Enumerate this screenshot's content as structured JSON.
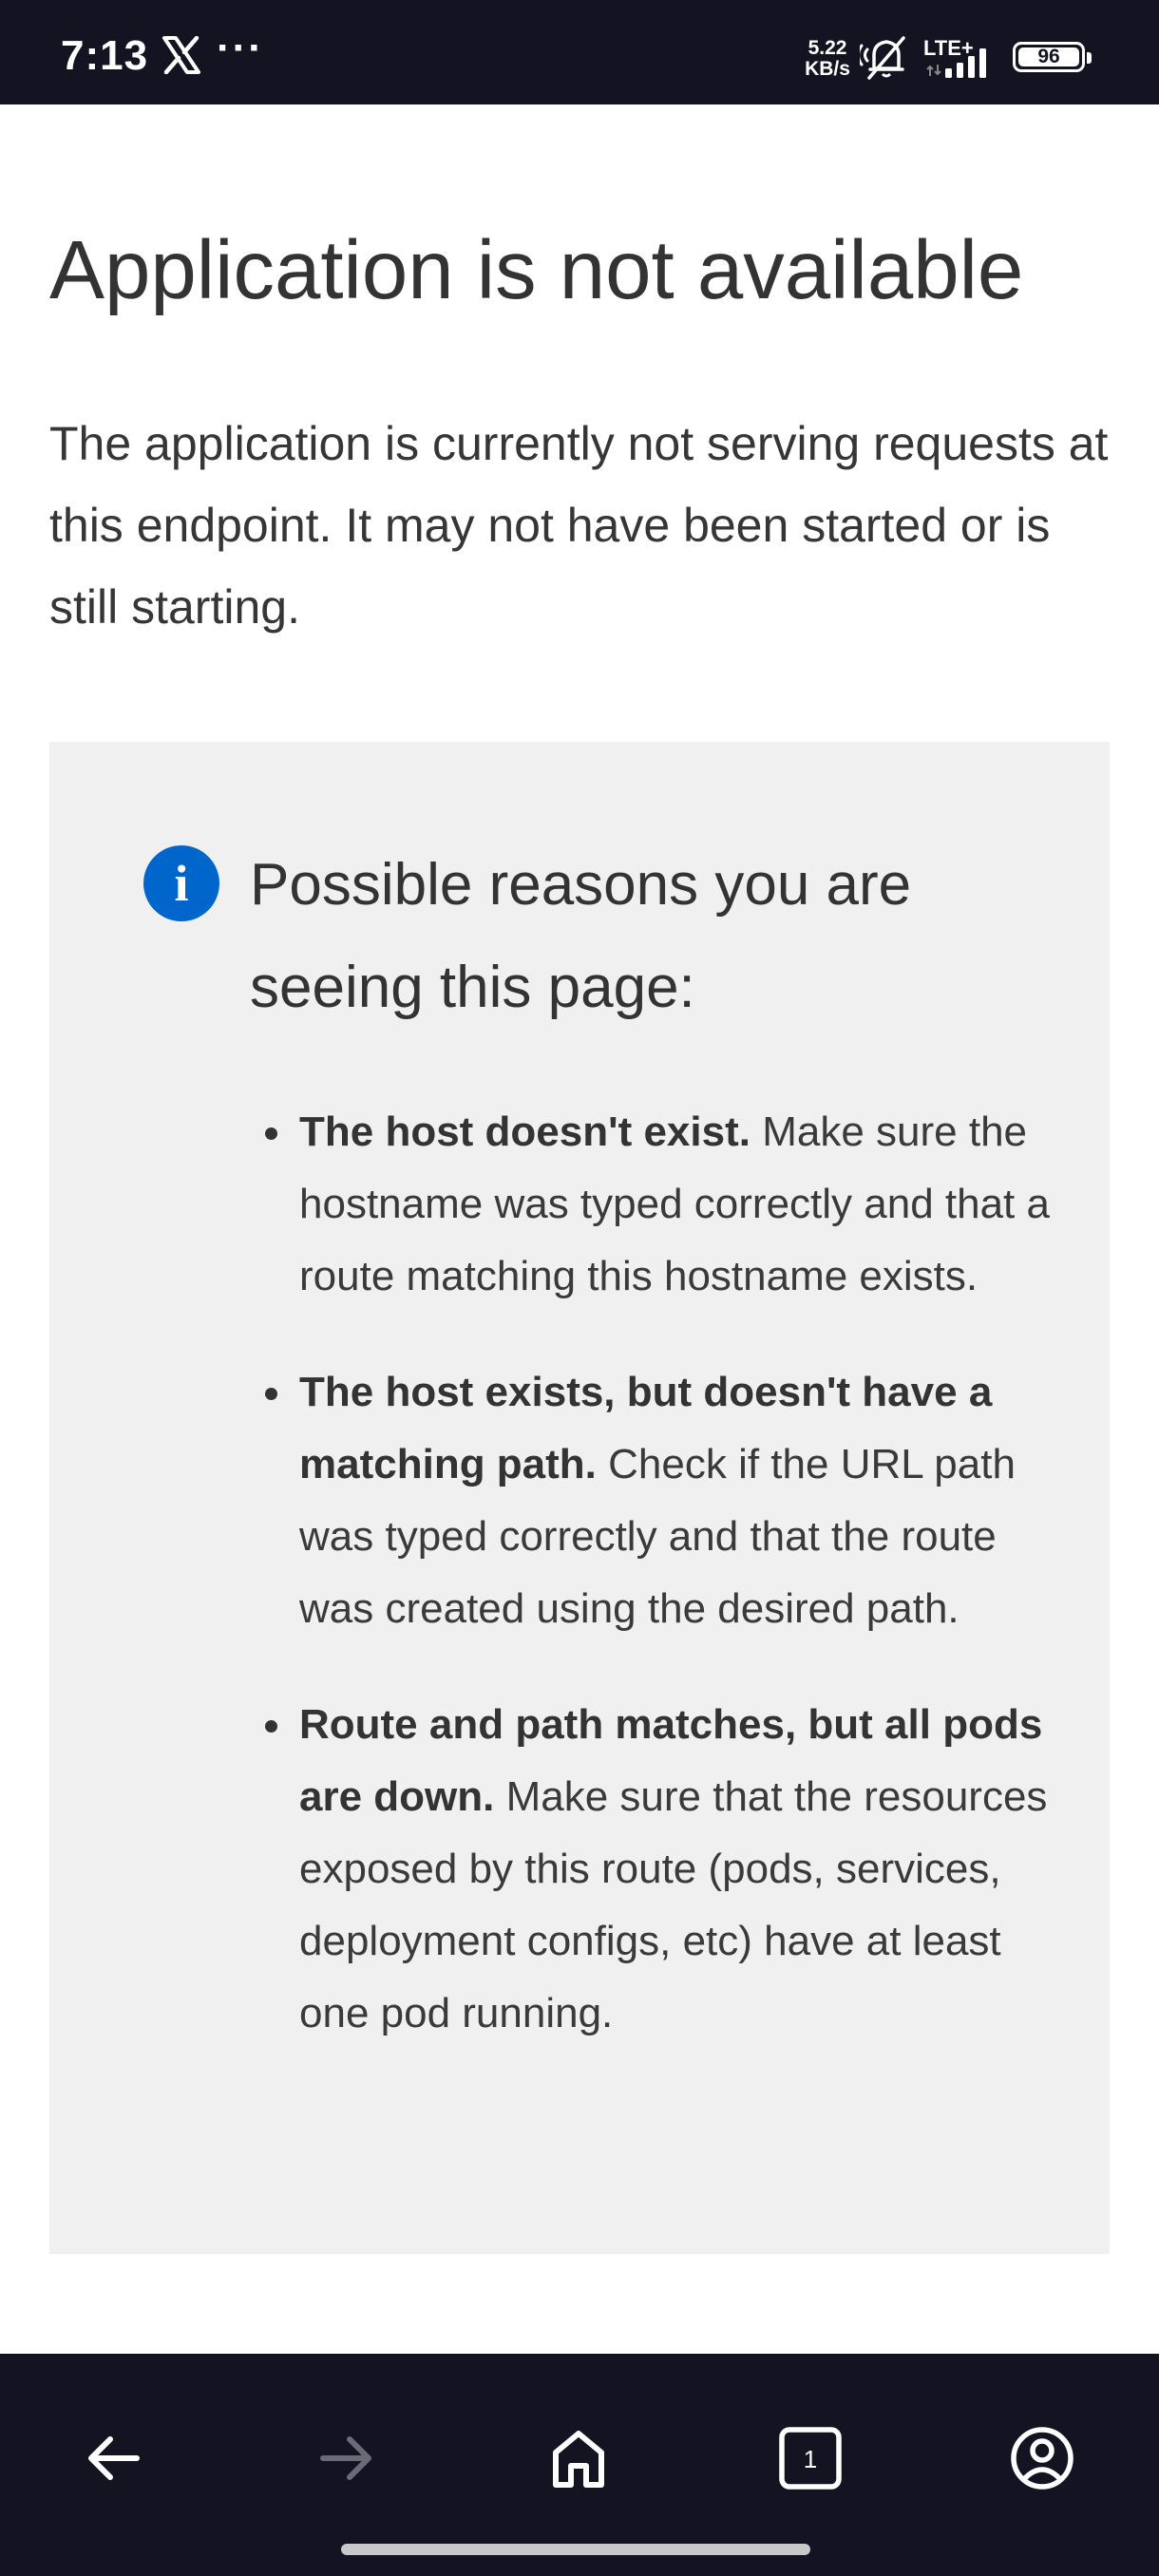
{
  "status_bar": {
    "time": "7:13",
    "notification_icons": [
      "x-logo-icon",
      "more-dots-icon"
    ],
    "more_dots": "···",
    "net_speed_value": "5.22",
    "net_speed_unit": "KB/s",
    "network": "LTE+",
    "battery": "96"
  },
  "page": {
    "title": "Application is not available",
    "intro": "The application is currently not serving requests at this endpoint. It may not have been started or is still starting.",
    "panel": {
      "heading": "Possible reasons you are seeing this page:",
      "reasons": [
        {
          "bold": "The host doesn't exist.",
          "text": " Make sure the hostname was typed correctly and that a route matching this hostname exists."
        },
        {
          "bold": "The host exists, but doesn't have a matching path.",
          "text": " Check if the URL path was typed correctly and that the route was created using the desired path."
        },
        {
          "bold": "Route and path matches, but all pods are down.",
          "text": " Make sure that the resources exposed by this route (pods, services, deployment configs, etc) have at least one pod running."
        }
      ]
    },
    "colors": {
      "info_accent": "#0066cc",
      "panel_bg": "#f0f0f0",
      "text": "#333333"
    }
  },
  "bottom_nav": {
    "tab_count": "1",
    "icons": [
      "back-arrow-icon",
      "forward-arrow-icon",
      "home-icon",
      "tabs-icon",
      "account-icon"
    ]
  }
}
